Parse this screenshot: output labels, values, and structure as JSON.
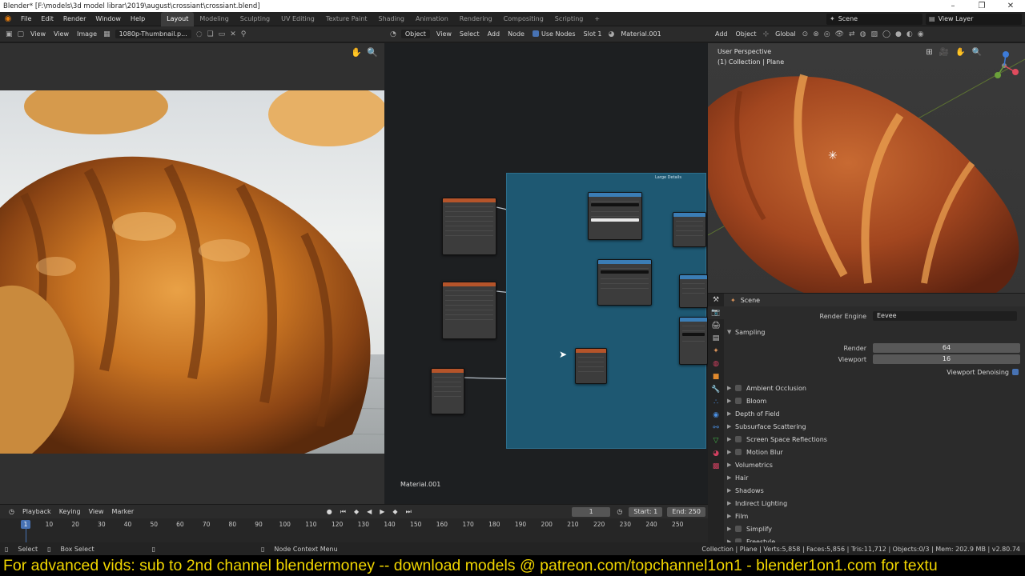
{
  "window": {
    "title": "Blender* [F:\\models\\3d model librar\\2019\\august\\crossiant\\crossiant.blend]",
    "minimize": "–",
    "maximize": "❐",
    "close": "✕"
  },
  "menu": [
    "File",
    "Edit",
    "Render",
    "Window",
    "Help"
  ],
  "workspaces": [
    "Layout",
    "Modeling",
    "Sculpting",
    "UV Editing",
    "Texture Paint",
    "Shading",
    "Animation",
    "Rendering",
    "Compositing",
    "Scripting"
  ],
  "workspace_add": "+",
  "scene_name": "Scene",
  "view_layer": "View Layer",
  "image_editor": {
    "menus": [
      "View",
      "View",
      "Image"
    ],
    "image_name": "1080p-Thumbnail.p...",
    "icons": {
      "hand": "✋",
      "zoom": "🔍"
    }
  },
  "node_editor": {
    "mode": "Object",
    "menus": [
      "View",
      "Select",
      "Add",
      "Node"
    ],
    "use_nodes": "Use Nodes",
    "slot": "Slot 1",
    "material": "Material.001",
    "frame_label": "Large Details",
    "material_label": "Material.001"
  },
  "viewport": {
    "menus": [
      "Add",
      "Object"
    ],
    "orientation": "Global",
    "overlay_title": "User Perspective",
    "overlay_collection": "(1) Collection | Plane"
  },
  "properties": {
    "context": "Scene",
    "render_engine_label": "Render Engine",
    "render_engine_value": "Eevee",
    "sampling": "Sampling",
    "render_label": "Render",
    "render_value": "64",
    "viewport_label": "Viewport",
    "viewport_value": "16",
    "denoise_label": "Viewport Denoising",
    "sections": [
      {
        "label": "Ambient Occlusion",
        "checkbox": true
      },
      {
        "label": "Bloom",
        "checkbox": true
      },
      {
        "label": "Depth of Field",
        "checkbox": false
      },
      {
        "label": "Subsurface Scattering",
        "checkbox": false
      },
      {
        "label": "Screen Space Reflections",
        "checkbox": true
      },
      {
        "label": "Motion Blur",
        "checkbox": true
      },
      {
        "label": "Volumetrics",
        "checkbox": false
      },
      {
        "label": "Hair",
        "checkbox": false
      },
      {
        "label": "Shadows",
        "checkbox": false
      },
      {
        "label": "Indirect Lighting",
        "checkbox": false
      },
      {
        "label": "Film",
        "checkbox": false
      },
      {
        "label": "Simplify",
        "checkbox": true
      },
      {
        "label": "Freestyle",
        "checkbox": true
      }
    ]
  },
  "timeline": {
    "menus": [
      "Playback",
      "Keying",
      "View",
      "Marker"
    ],
    "current_frame": "1",
    "start_label": "Start:",
    "start_value": "1",
    "end_label": "End:",
    "end_value": "250",
    "ticks": [
      "10",
      "20",
      "30",
      "40",
      "50",
      "60",
      "70",
      "80",
      "90",
      "100",
      "110",
      "120",
      "130",
      "140",
      "150",
      "160",
      "170",
      "180",
      "190",
      "200",
      "210",
      "220",
      "230",
      "240",
      "250"
    ],
    "cursor": "1"
  },
  "status": {
    "select": "Select",
    "box_select": "Box Select",
    "node_menu": "Node Context Menu",
    "stats": "Collection | Plane | Verts:5,858 | Faces:5,856 | Tris:11,712 | Objects:0/3 | Mem: 202.9 MB | v2.80.74"
  },
  "banner": "For advanced vids: sub to 2nd channel blendermoney -- download models @ patreon.com/topchannel1on1 - blender1on1.com for textu",
  "colors": {
    "accent": "#4772b3",
    "blender_orange": "#e87d0d",
    "banner_text": "#f1d600",
    "frame": "#1e5872"
  }
}
